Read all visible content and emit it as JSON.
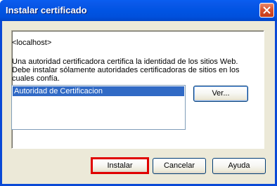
{
  "window": {
    "title": "Instalar certificado",
    "close_icon": "close-icon"
  },
  "content": {
    "host": "<localhost>",
    "description": "Una autoridad certificadora certifica la identidad de los sitios Web. Debe instalar sólamente autoridades certificadoras de sitios en los cuales confía.",
    "list_items": [
      {
        "label": "Autoridad de Certificacion",
        "selected": true
      }
    ],
    "view_button": "Ver..."
  },
  "buttons": {
    "install": "Instalar",
    "cancel": "Cancelar",
    "help": "Ayuda"
  },
  "colors": {
    "title_bar": "#0054e3",
    "selection": "#316ac5",
    "highlight_border": "#e00000",
    "client_bg": "#ece9d8"
  }
}
